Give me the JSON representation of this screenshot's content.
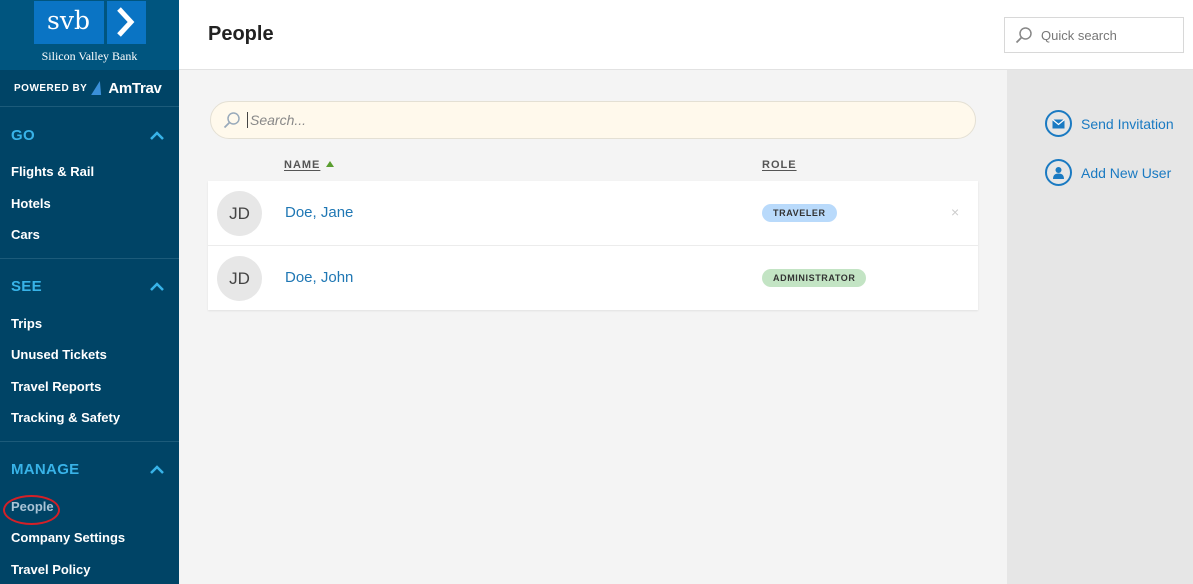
{
  "brand": {
    "logo_text": "svb",
    "logo_subtitle": "Silicon Valley Bank",
    "powered_by": "POWERED BY",
    "partner": "AmTrav"
  },
  "sidebar": {
    "sections": [
      {
        "label": "GO",
        "items": [
          "Flights & Rail",
          "Hotels",
          "Cars"
        ]
      },
      {
        "label": "SEE",
        "items": [
          "Trips",
          "Unused Tickets",
          "Travel Reports",
          "Tracking & Safety"
        ]
      },
      {
        "label": "MANAGE",
        "items": [
          "People",
          "Company Settings",
          "Travel Policy"
        ]
      }
    ],
    "active_item": "People"
  },
  "header": {
    "title": "People",
    "quick_search_placeholder": "Quick search"
  },
  "main": {
    "search_placeholder": "Search...",
    "columns": {
      "name": "NAME",
      "role": "ROLE"
    },
    "people": [
      {
        "initials": "JD",
        "name": "Doe, Jane",
        "role": "TRAVELER",
        "remove": "×"
      },
      {
        "initials": "JD",
        "name": "Doe, John",
        "role": "ADMINISTRATOR"
      }
    ]
  },
  "actions": {
    "send_invitation": "Send Invitation",
    "add_new_user": "Add New User"
  },
  "colors": {
    "sidebar_bg": "#004466",
    "section_heading": "#38b3e8",
    "link": "#1f77b4",
    "traveler_badge": "#b9dafb",
    "admin_badge": "#c3e4c4",
    "active_highlight": "#d42027"
  }
}
